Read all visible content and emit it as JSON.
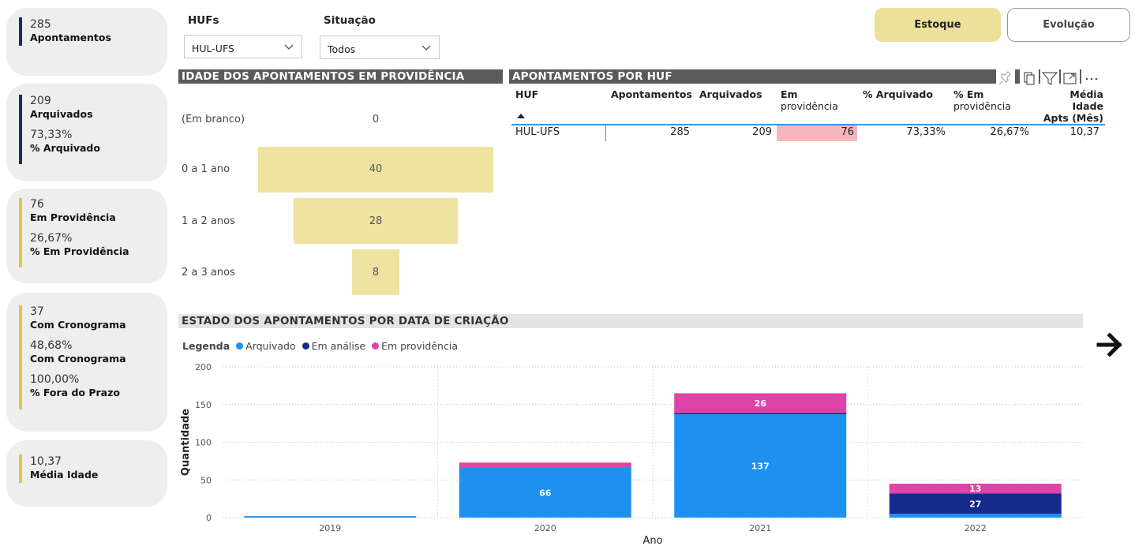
{
  "kpis": {
    "apontamentos": {
      "value": "285",
      "label": "Apontamentos"
    },
    "arquivados": {
      "value": "209",
      "label": "Arquivados",
      "pct": "73,33%",
      "pct_label": "% Arquivado"
    },
    "providencia": {
      "value": "76",
      "label": "Em Providência",
      "pct": "26,67%",
      "pct_label": "% Em Providência"
    },
    "cronograma": {
      "value": "37",
      "label": "Com Cronograma",
      "pct": "48,68%",
      "pct_label": "Com Cronograma",
      "prazo": "100,00%",
      "prazo_label": "% Fora do Prazo"
    },
    "idade": {
      "value": "10,37",
      "label": "Média Idade"
    }
  },
  "slicers": {
    "hufs": {
      "label": "HUFs",
      "value": "HUL-UFS"
    },
    "situacao": {
      "label": "Situação",
      "value": "Todos"
    }
  },
  "buttons": {
    "estoque": "Estoque",
    "evolucao": "Evolução"
  },
  "funnel": {
    "title": "IDADE DOS APONTAMENTOS EM PROVIDÊNCIA",
    "rows": [
      {
        "label": "(Em branco)",
        "value": 0
      },
      {
        "label": "0 a 1 ano",
        "value": 40
      },
      {
        "label": "1 a 2 anos",
        "value": 28
      },
      {
        "label": "2 a 3 anos",
        "value": 8
      }
    ]
  },
  "table": {
    "title": "APONTAMENTOS POR HUF",
    "headers": {
      "huf": "HUF",
      "apontamentos": "Apontamentos",
      "arquivados": "Arquivados",
      "em_prov_1": "Em",
      "em_prov_2": "providência",
      "pct_arq": "% Arquivado",
      "pct_em_1": "% Em",
      "pct_em_2": "providência",
      "media_1": "Média Idade",
      "media_2": "Apts (Mês)"
    },
    "row": {
      "huf": "HUL-UFS",
      "apontamentos": "285",
      "arquivados": "209",
      "em_providencia": "76",
      "pct_arquivado": "73,33%",
      "pct_em_providencia": "26,67%",
      "media_idade": "10,37"
    }
  },
  "chart_title": "ESTADO DOS APONTAMENTOS POR DATA DE CRIAÇÃO",
  "legend": {
    "title": "Legenda",
    "items": [
      "Arquivado",
      "Em análise",
      "Em providência"
    ]
  },
  "colors": {
    "accent": "#e3c640",
    "dark": "#1b2a6b",
    "arquivado": "#1e90f0",
    "em_analise": "#142a8c",
    "em_providencia": "#dd44a6",
    "funnel": "#efe3a2",
    "highlight": "#f4b6bc",
    "estoque_btn": "#ede09a"
  },
  "chart_data": {
    "type": "bar",
    "stacked": true,
    "categories": [
      "2019",
      "2020",
      "2021",
      "2022"
    ],
    "series": [
      {
        "name": "Arquivado",
        "values": [
          2,
          66,
          137,
          5
        ]
      },
      {
        "name": "Em análise",
        "values": [
          0,
          0,
          2,
          27
        ]
      },
      {
        "name": "Em providência",
        "values": [
          0,
          7,
          26,
          13
        ]
      }
    ],
    "data_labels": [
      [
        null,
        null,
        null
      ],
      [
        66,
        null,
        null
      ],
      [
        137,
        null,
        26
      ],
      [
        null,
        27,
        13
      ]
    ],
    "xlabel": "Ano",
    "ylabel": "Quantidade",
    "ylim": [
      0,
      200
    ],
    "yticks": [
      0,
      50,
      100,
      150,
      200
    ],
    "grid": true,
    "legend_position": "top-left"
  }
}
